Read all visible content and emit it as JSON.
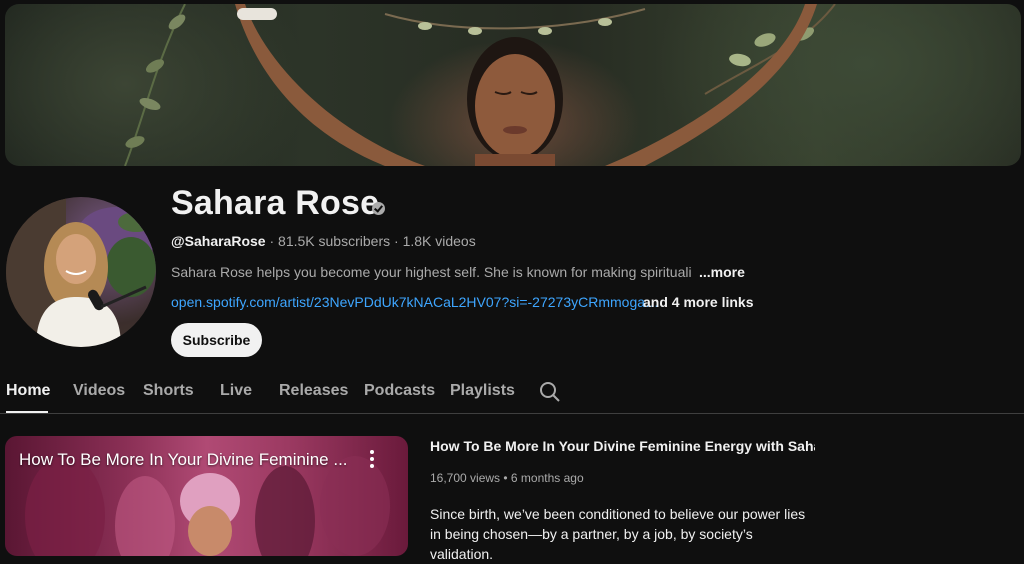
{
  "channel": {
    "name": "Sahara Rose",
    "handle": "@SaharaRose",
    "subscribers": "81.5K subscribers",
    "videos": "1.8K videos",
    "separator": "·",
    "description": "Sahara Rose helps you become your highest self. She is known for making spirituality fun",
    "more_label": "...more",
    "link": "open.spotify.com/artist/23NevPDdUk7kNACaL2HV07?si=-27273yCRmmoga…",
    "more_links": "and 4 more links",
    "subscribe_label": "Subscribe",
    "verified_icon": "verified-check-icon"
  },
  "tabs": [
    {
      "label": "Home",
      "active": true
    },
    {
      "label": "Videos"
    },
    {
      "label": "Shorts"
    },
    {
      "label": "Live"
    },
    {
      "label": "Releases"
    },
    {
      "label": "Podcasts"
    },
    {
      "label": "Playlists"
    }
  ],
  "featured_video": {
    "thumb_title": "How To Be More In Your Divine Feminine ...",
    "title": "How To Be More In Your Divine Feminine Energy with Sahara R...",
    "stats": "16,700 views • 6 months ago",
    "description": "Since birth, we’ve been conditioned to believe our power lies in being chosen—by a partner, by a job, by society’s validation."
  },
  "colors": {
    "background": "#0f0f0f",
    "link": "#3ea6ff",
    "text": "#f1f1f1",
    "muted": "#aaaaaa"
  }
}
